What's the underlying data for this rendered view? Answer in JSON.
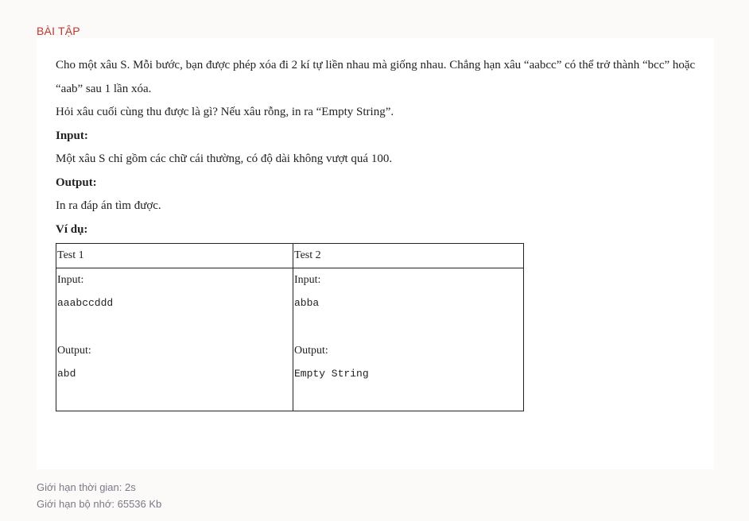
{
  "section_title": "BÀI TẬP",
  "problem": {
    "paragraph1": "Cho một xâu S. Mỗi bước, bạn được phép xóa đi 2 kí tự liền nhau mà giống nhau. Chẳng hạn xâu “aabcc” có thể trở thành “bcc” hoặc “aab” sau 1 lần xóa.",
    "paragraph2": "Hỏi xâu cuối cùng thu được là gì? Nếu xâu rỗng, in ra “Empty String”.",
    "input_heading": "Input:",
    "input_desc": "Một xâu S chỉ gồm các chữ cái thường, có độ dài không vượt quá 100.",
    "output_heading": "Output:",
    "output_desc": "In ra đáp án tìm được.",
    "example_heading": "Ví dụ:"
  },
  "examples": {
    "headers": [
      "Test 1",
      "Test 2"
    ],
    "tests": [
      {
        "input_label": "Input:",
        "input": "aaabccddd",
        "output_label": "Output:",
        "output": "abd"
      },
      {
        "input_label": "Input:",
        "input": "abba",
        "output_label": "Output:",
        "output": "Empty String"
      }
    ]
  },
  "limits": {
    "time": "Giới hạn thời gian: 2s",
    "memory": "Giới hạn bộ nhớ: 65536 Kb"
  }
}
